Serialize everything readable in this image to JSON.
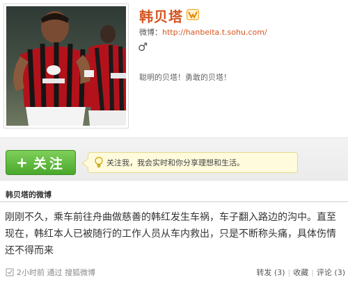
{
  "profile": {
    "name": "韩贝塔",
    "blog_label": "微博：",
    "blog_url": "http://hanbeita.t.sohu.com/",
    "gender_symbol": "♂",
    "description": "聪明的贝塔！勇敢的贝塔！"
  },
  "follow": {
    "plus": "+",
    "label": "关注",
    "tip": "关注我，我会实时和你分享理想和生活。"
  },
  "feed": {
    "title": "韩贝塔的微博",
    "post_text": "刚刚不久，乘车前往舟曲做慈善的韩红发生车祸，车子翻入路边的沟中。直至现在，韩红本人已被随行的工作人员从车内救出，只是不断称头痛，具体伤情还不得而来",
    "time": "2小时前",
    "via": "通过",
    "source": "搜狐微博",
    "repost": "转发 (3)",
    "favorite": "收藏",
    "comment": "评论 (3)"
  },
  "colors": {
    "accent": "#d4541f",
    "follow_green": "#4aa82b",
    "tip_bg": "#fffbdc"
  }
}
